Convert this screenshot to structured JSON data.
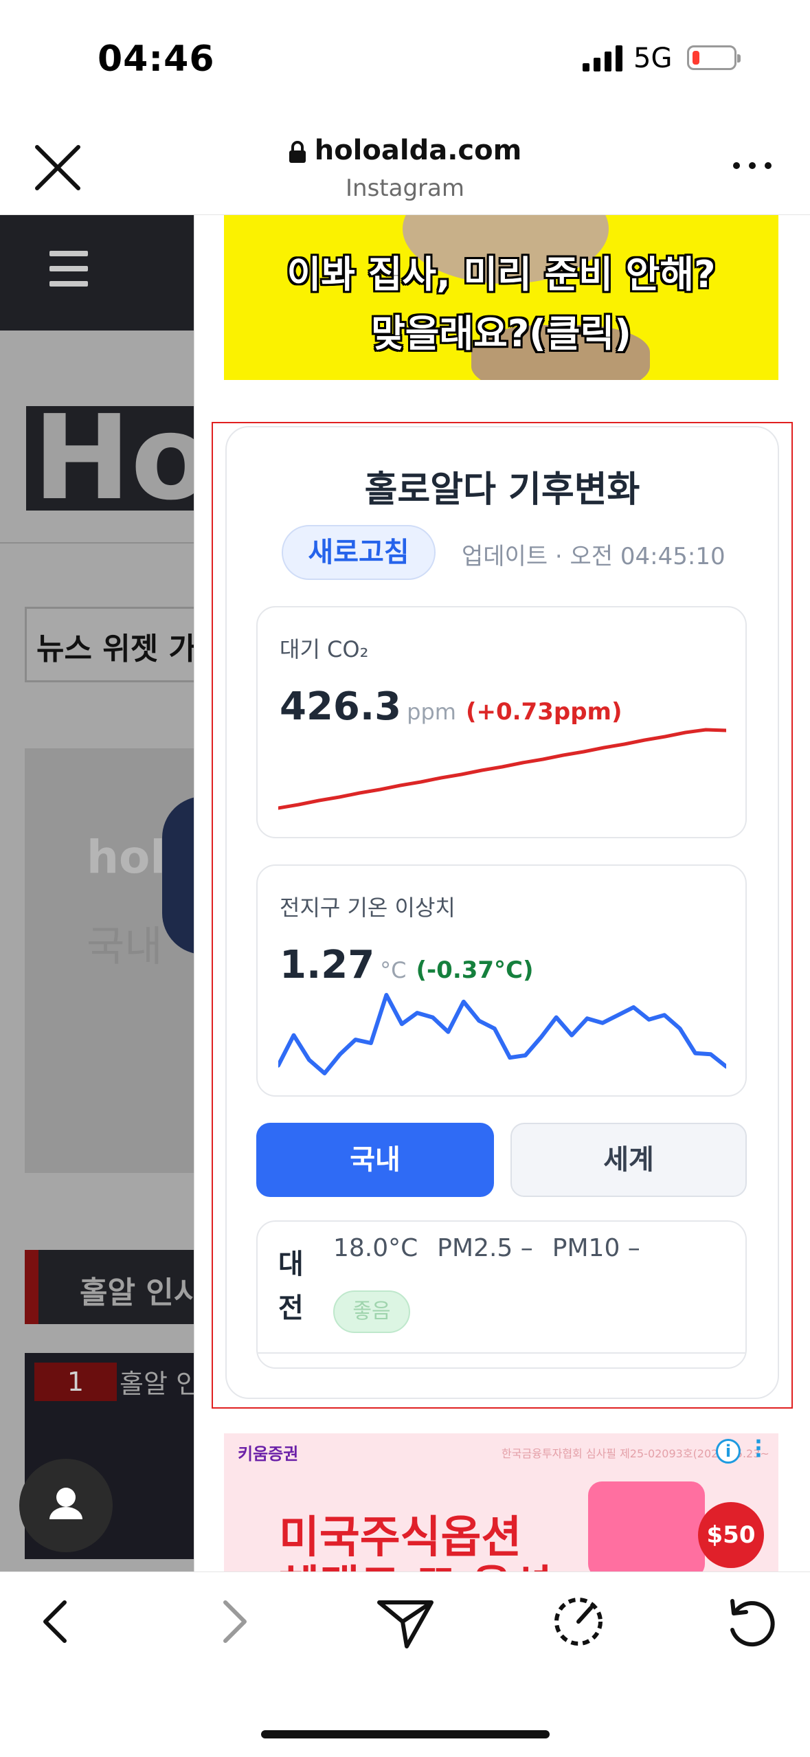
{
  "status_bar": {
    "time": "04:46",
    "network": "5G"
  },
  "browser": {
    "host": "holoalda.com",
    "app": "Instagram"
  },
  "underlay": {
    "logo_text": "Hol",
    "news_box": "뉴스 위젯 가",
    "banner_line1": "holo",
    "banner_line2": "국내",
    "hot_header": "홀알 인시",
    "item_rank": "1",
    "item_text": "홀알 인"
  },
  "ad_top": {
    "line1": "이봐 집사, 미리 준비 안해?",
    "line2": "맞을래요?(클릭)"
  },
  "widget": {
    "title": "홀로알다 기후변화",
    "refresh_label": "새로고침",
    "update_text": "업데이트 · 오전 04:45:10",
    "co2": {
      "label": "대기 CO₂",
      "value": "426.3",
      "unit": "ppm",
      "delta": "(+0.73ppm)",
      "color": "#dc2626",
      "series": [
        0,
        0.5,
        1.1,
        1.6,
        2.2,
        2.7,
        3.3,
        3.8,
        4.4,
        4.9,
        5.5,
        6.0,
        6.6,
        7.1,
        7.7,
        8.2,
        8.8,
        9.3,
        9.9,
        10.4,
        11.0,
        11.4,
        11.3
      ]
    },
    "temp": {
      "label": "전지구 기온 이상치",
      "value": "1.27",
      "unit": "°C",
      "delta": "(-0.37°C)",
      "color": "#2f6bf5",
      "series": [
        1.05,
        1.32,
        1.1,
        0.98,
        1.15,
        1.28,
        1.25,
        1.68,
        1.42,
        1.52,
        1.48,
        1.35,
        1.62,
        1.45,
        1.38,
        1.12,
        1.14,
        1.3,
        1.48,
        1.32,
        1.47,
        1.43,
        1.5,
        1.57,
        1.46,
        1.5,
        1.38,
        1.16,
        1.15,
        1.04
      ]
    },
    "tabs": {
      "domestic": "국내",
      "world": "세계"
    },
    "city": {
      "name": "대전",
      "temp": "18.0°C",
      "pm25": "PM2.5 –",
      "pm10": "PM10 –",
      "air_quality": "좋음"
    }
  },
  "ad_bottom": {
    "brand": "키움증권",
    "notice": "한국금융투자협회 심사필 제25-02093호(2025.05.23~",
    "headline1": "미국주식옵션",
    "headline2": "혜택도 또 옵션",
    "badge": "$50"
  },
  "colors": {
    "accent": "#2f6bf5",
    "alert": "#dc2626",
    "good": "#15803d"
  }
}
